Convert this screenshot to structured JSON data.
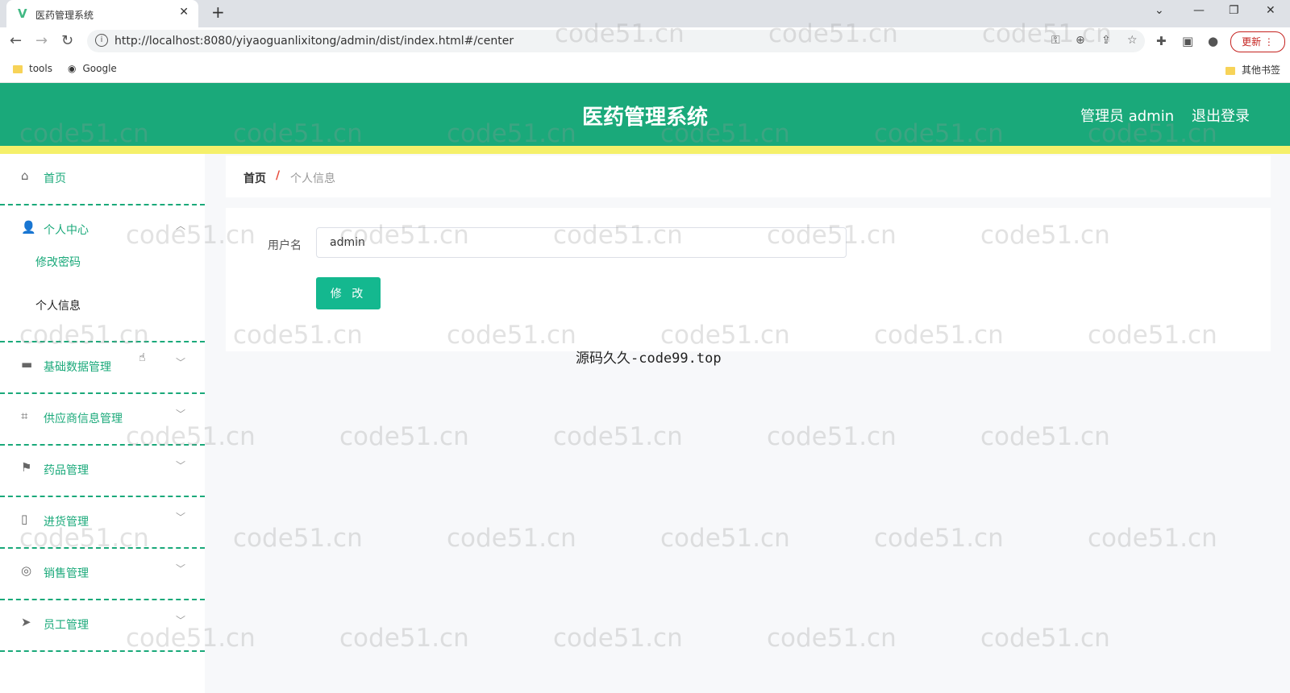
{
  "browser": {
    "tab_title": "医药管理系统",
    "tab_favicon": "V",
    "close_glyph": "✕",
    "new_tab_glyph": "+",
    "url": "http://localhost:8080/yiyaoguanlixitong/admin/dist/index.html#/center",
    "update_label": "更新",
    "bookmarks": [
      {
        "label": "tools",
        "icon": "folder-icon"
      },
      {
        "label": "Google",
        "icon": "globe-icon"
      }
    ],
    "other_bookmarks": "其他书签"
  },
  "header": {
    "title": "医药管理系统",
    "user": "管理员 admin",
    "logout": "退出登录",
    "color": "#1aa97a",
    "accent_bar": "#f5f06a"
  },
  "sidebar": {
    "items": [
      {
        "label": "首页",
        "icon": "home-icon",
        "expandable": false
      },
      {
        "label": "个人中心",
        "icon": "user-icon",
        "expandable": true,
        "expanded": true,
        "children": [
          {
            "label": "修改密码",
            "active": false
          },
          {
            "label": "个人信息",
            "active": true
          }
        ]
      },
      {
        "label": "基础数据管理",
        "icon": "monitor-icon",
        "expandable": true
      },
      {
        "label": "供应商信息管理",
        "icon": "crop-icon",
        "expandable": true
      },
      {
        "label": "药品管理",
        "icon": "flag-icon",
        "expandable": true
      },
      {
        "label": "进货管理",
        "icon": "mic-icon",
        "expandable": true
      },
      {
        "label": "销售管理",
        "icon": "help-ring-icon",
        "expandable": true
      },
      {
        "label": "员工管理",
        "icon": "send-icon",
        "expandable": true
      }
    ]
  },
  "breadcrumb": {
    "home": "首页",
    "separator": "/",
    "current": "个人信息"
  },
  "form": {
    "username_label": "用户名",
    "username_value": "admin",
    "submit_label": "修 改"
  },
  "overlay_text": "源码久久-code99.top",
  "watermark": "code51.cn"
}
